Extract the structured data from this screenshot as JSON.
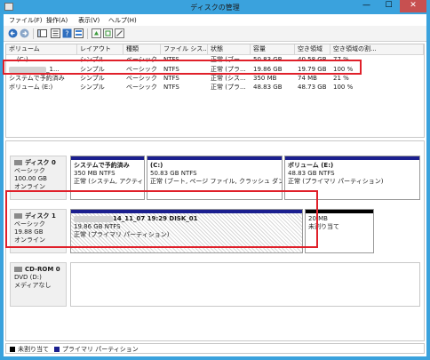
{
  "window": {
    "title": "ディスクの管理",
    "min_glyph": "—",
    "max_glyph": "☐",
    "close_glyph": "✕"
  },
  "menu": [
    {
      "label": "ファイル(F)",
      "name": "menu-file"
    },
    {
      "label": "操作(A)",
      "name": "menu-action"
    },
    {
      "label": "表示(V)",
      "name": "menu-view"
    },
    {
      "label": "ヘルプ(H)",
      "name": "menu-help"
    }
  ],
  "toolbar": {
    "icons": [
      "back-arrow-icon",
      "forward-arrow-icon",
      "console-tree-icon",
      "help-icon",
      "properties-icon",
      "refresh-icon",
      "export-icon",
      "settings-icon"
    ]
  },
  "table": {
    "headers": [
      "ボリューム",
      "レイアウト",
      "種類",
      "ファイル シス...",
      "状態",
      "容量",
      "空き領域",
      "空き領域の割..."
    ],
    "rows": [
      {
        "volume": "(C:)",
        "layout": "シンプル",
        "type": "ベーシック",
        "fs": "NTFS",
        "status": "正常 (ブー...",
        "capacity": "50.83 GB",
        "free": "40.58 GB",
        "pct": "77 %"
      },
      {
        "volume": "_1...",
        "layout": "シンプル",
        "type": "ベーシック",
        "fs": "NTFS",
        "status": "正常 (プラ...",
        "capacity": "19.86 GB",
        "free": "19.79 GB",
        "pct": "100 %"
      },
      {
        "volume": "システムで予約済み",
        "layout": "シンプル",
        "type": "ベーシック",
        "fs": "NTFS",
        "status": "正常 (シス...",
        "capacity": "350 MB",
        "free": "74 MB",
        "pct": "21 %"
      },
      {
        "volume": "ボリューム (E:)",
        "layout": "シンプル",
        "type": "ベーシック",
        "fs": "NTFS",
        "status": "正常 (プラ...",
        "capacity": "48.83 GB",
        "free": "48.73 GB",
        "pct": "100 %"
      }
    ]
  },
  "disks": [
    {
      "name": "ディスク 0",
      "kind": "ベーシック",
      "size": "100.00 GB",
      "state": "オンライン",
      "partitions": [
        {
          "title": "システムで予約済み",
          "line1": "350 MB NTFS",
          "line2": "正常 (システム, アクティブ, プライマリ パーティション)",
          "color": "#1b1f8f"
        },
        {
          "title": "(C:)",
          "line1": "50.83 GB NTFS",
          "line2": "正常 (ブート, ページ ファイル, クラッシュ ダンプ, プライ",
          "color": "#1b1f8f"
        },
        {
          "title": "ボリューム (E:)",
          "line1": "48.83 GB NTFS",
          "line2": "正常 (プライマリ パーティション)",
          "color": "#1b1f8f"
        }
      ]
    },
    {
      "name": "ディスク 1",
      "kind": "ベーシック",
      "size": "19.88 GB",
      "state": "オンライン",
      "partitions": [
        {
          "title": "14_11_07 19:29 DISK_01",
          "line1": "19.86 GB NTFS",
          "line2": "正常 (プライマリ パーティション)",
          "color": "#1b1f8f"
        },
        {
          "title": "",
          "line1": "20 MB",
          "line2": "未割り当て",
          "color": "#000000"
        }
      ]
    },
    {
      "name": "CD-ROM 0",
      "kind": "DVD (D:)",
      "size": "",
      "state": "メディアなし"
    }
  ],
  "legend": [
    {
      "label": "未割り当て",
      "color": "#000000"
    },
    {
      "label": "プライマリ パーティション",
      "color": "#1b1f8f"
    }
  ],
  "colors": {
    "titlebar": "#3aa2dd",
    "highlight": "#e0202a",
    "primary_partition": "#1b1f8f"
  }
}
